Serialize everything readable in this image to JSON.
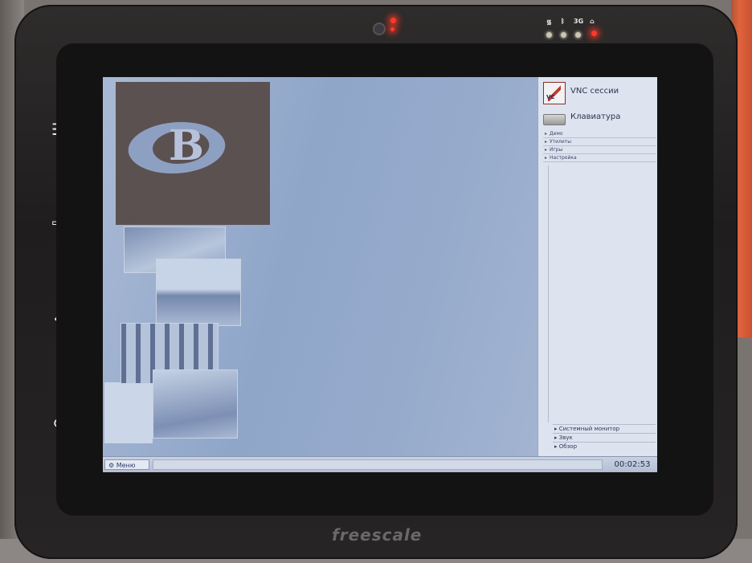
{
  "device": {
    "brand": "freescale",
    "status_glyphs": [
      "3G"
    ]
  },
  "panel": {
    "launchers": [
      {
        "label": "VNC сессии",
        "icon": "vnc-icon"
      },
      {
        "label": "Клавиатура",
        "icon": "keyboard-icon"
      }
    ],
    "menu_items": [
      "Демо",
      "Утилиты",
      "Игры",
      "Настройка"
    ],
    "bottom_items": [
      "Системный монитор",
      "Звук",
      "Обзор"
    ]
  },
  "taskbar": {
    "menu_label": "Меню",
    "clock": "00:02:53"
  }
}
